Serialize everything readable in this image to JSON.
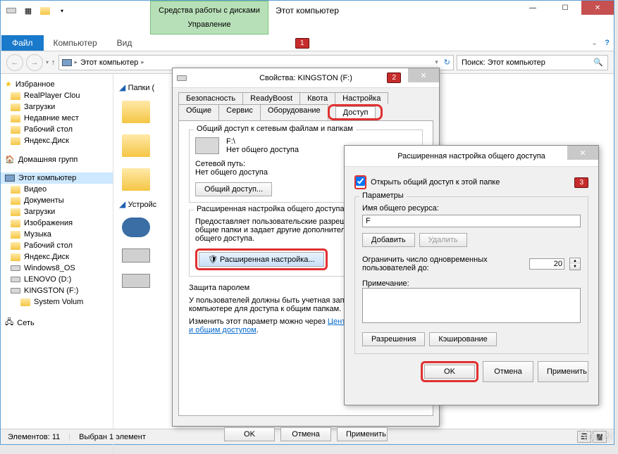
{
  "window": {
    "title": "Этот компьютер",
    "contextual_tab": "Средства работы с дисками",
    "contextual_sub": "Управление",
    "file_tab": "Файл",
    "tabs": [
      "Компьютер",
      "Вид"
    ],
    "badge1": "1"
  },
  "nav": {
    "breadcrumb": "Этот компьютер",
    "search_placeholder": "Поиск: Этот компьютер"
  },
  "tree": {
    "favorites": "Избранное",
    "fav_items": [
      "RealPlayer Clou",
      "Загрузки",
      "Недавние мест",
      "Рабочий стол",
      "Яндекс.Диск"
    ],
    "homegroup": "Домашняя групп",
    "this_pc": "Этот компьютер",
    "pc_items": [
      "Видео",
      "Документы",
      "Загрузки",
      "Изображения",
      "Музыка",
      "Рабочий стол",
      "Яндекс.Диск",
      "Windows8_OS",
      "LENOVO (D:)",
      "KINGSTON (F:)"
    ],
    "pc_sub": "System Volum",
    "network": "Сеть"
  },
  "content": {
    "folders_hdr": "Папки (",
    "devices_hdr": "Устройс"
  },
  "status": {
    "count": "Элементов: 11",
    "selected": "Выбран 1 элемент"
  },
  "props": {
    "title": "Свойства: KINGSTON (F:)",
    "badge": "2",
    "tabs_row1": [
      "Безопасность",
      "ReadyBoost",
      "Квота",
      "Настройка"
    ],
    "tabs_row2": [
      "Общие",
      "Сервис",
      "Оборудование"
    ],
    "tab_active": "Доступ",
    "group1": "Общий доступ к сетевым файлам и папкам",
    "drive_path": "F:\\",
    "no_share": "Нет общего доступа",
    "netpath_lbl": "Сетевой путь:",
    "netpath_val": "Нет общего доступа",
    "share_btn": "Общий доступ...",
    "group2": "Расширенная настройка общего доступа",
    "group2_desc": "Предоставляет пользовательские разрешения, создает общие папки и задает другие дополнительные параметры общего доступа.",
    "adv_btn": "Расширенная настройка...",
    "group3": "Защита паролем",
    "group3_desc": "У пользователей должны быть учетная запись и пароль на этом компьютере для доступа к общим папкам.",
    "change_prefix": "Изменить этот параметр можно через ",
    "change_link": "Центр управления сетями и общим доступом",
    "ok": "OK",
    "cancel": "Отмена",
    "apply": "Применить"
  },
  "adv": {
    "title": "Расширенная настройка общего доступа",
    "badge": "3",
    "chk_label": "Открыть общий доступ к этой папке",
    "params": "Параметры",
    "name_lbl": "Имя общего ресурса:",
    "name_val": "F",
    "add_btn": "Добавить",
    "remove_btn": "Удалить",
    "limit_lbl": "Ограничить число одновременных пользователей до:",
    "limit_val": "20",
    "note_lbl": "Примечание:",
    "perm_btn": "Разрешения",
    "cache_btn": "Кэширование",
    "ok": "OK",
    "cancel": "Отмена",
    "apply": "Применить"
  },
  "watermark": "Sovet"
}
